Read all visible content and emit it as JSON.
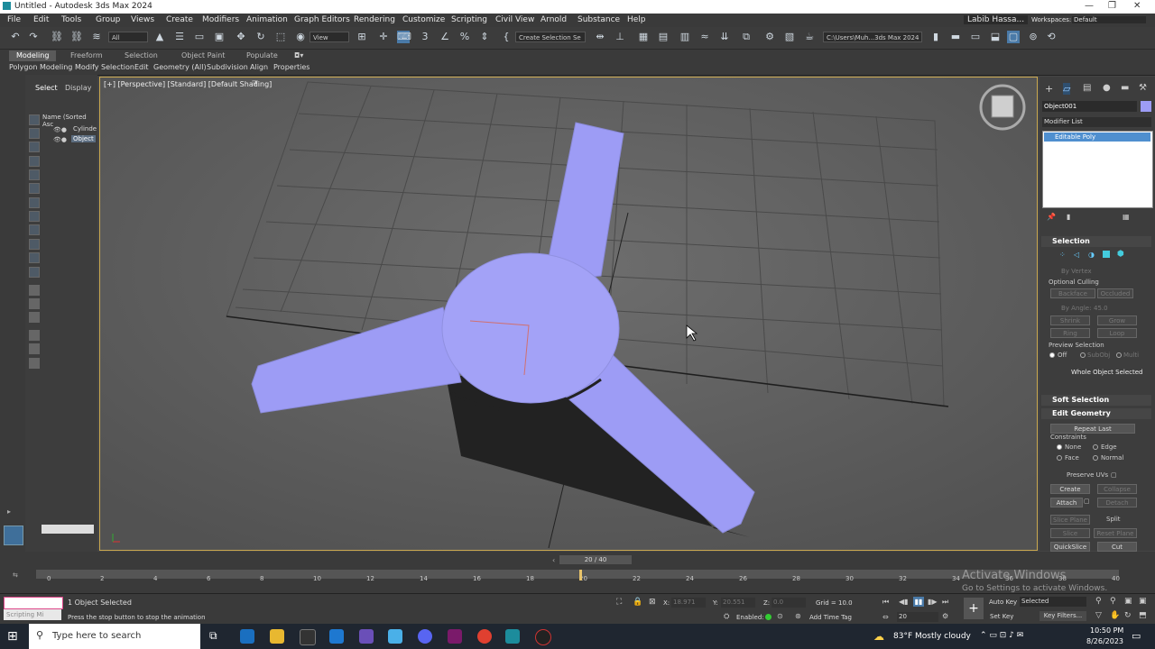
{
  "window": {
    "title": "Untitled - Autodesk 3ds Max 2024",
    "controls": [
      "—",
      "❐",
      "✕"
    ]
  },
  "menus": [
    "File",
    "Edit",
    "Tools",
    "Group",
    "Views",
    "Create",
    "Modifiers",
    "Animation",
    "Graph Editors",
    "Rendering",
    "Customize",
    "Scripting",
    "Civil View",
    "Arnold",
    "Substance",
    "Help"
  ],
  "user": {
    "name": "Labib Hassa...",
    "workspace_label": "Workspaces:",
    "workspace": "Default"
  },
  "toolbar": {
    "filter": "All",
    "view": "View",
    "selection_set": "Create Selection Se",
    "path": "C:\\Users\\Muh...3ds Max 2024"
  },
  "ribbon": {
    "tabs": [
      "Modeling",
      "Freeform",
      "Selection",
      "Object Paint",
      "Populate"
    ],
    "active_tab": "Modeling",
    "subtabs": [
      "Polygon Modeling",
      "Modify Selection",
      "Edit",
      "Geometry (All)",
      "Subdivision",
      "Align",
      "Properties"
    ]
  },
  "scene_explorer": {
    "tabs": [
      "Select",
      "Display"
    ],
    "column_header": "Name (Sorted Asc",
    "items": [
      "Cylinde",
      "Object"
    ]
  },
  "viewport": {
    "label": "[+] [Perspective] [Standard] [Default Shading]",
    "object_color": "#9d9cf5"
  },
  "command_panel": {
    "object_name": "Object001",
    "modifier_list_label": "Modifier List",
    "stack_item": "Editable Poly",
    "selection": {
      "title": "Selection",
      "by_vertex": "By Vertex",
      "optional_culling": "Optional Culling",
      "backface": "Backface",
      "occluded": "Occluded",
      "by_angle": "By Angle:",
      "angle_value": "45.0",
      "shrink": "Shrink",
      "grow": "Grow",
      "ring": "Ring",
      "loop": "Loop",
      "preview_selection": "Preview Selection",
      "preview_options": [
        "Off",
        "SubObj",
        "Multi"
      ],
      "whole_object": "Whole Object Selected"
    },
    "soft_selection": "Soft Selection",
    "edit_geometry": {
      "title": "Edit Geometry",
      "repeat_last": "Repeat Last",
      "constraints": "Constraints",
      "constraint_options": [
        "None",
        "Edge",
        "Face",
        "Normal"
      ],
      "preserve_uvs": "Preserve UVs",
      "create": "Create",
      "collapse": "Collapse",
      "attach": "Attach",
      "detach": "Detach",
      "slice_plane": "Slice Plane",
      "split": "Split",
      "slice": "Slice",
      "reset_plane": "Reset Plane",
      "quickslice": "QuickSlice",
      "cut": "Cut"
    }
  },
  "timeline": {
    "frame_label": "20 / 40",
    "current_frame": 20,
    "total_frames": 40,
    "ticks": [
      "0",
      "2",
      "4",
      "6",
      "8",
      "10",
      "12",
      "14",
      "16",
      "18",
      "20",
      "22",
      "24",
      "26",
      "28",
      "30",
      "32",
      "34",
      "36",
      "38",
      "40"
    ]
  },
  "watermark": {
    "line1": "Activate Windows",
    "line2": "Go to Settings to activate Windows."
  },
  "status": {
    "script_box": "Scripting Mi",
    "selected": "1 Object Selected",
    "prompt": "Press the stop button to stop the animation",
    "x_label": "X:",
    "x_value": "18.971",
    "y_label": "Y:",
    "y_value": "20.551",
    "z_label": "Z:",
    "z_value": "0.0",
    "grid": "Grid = 10.0",
    "enabled": "Enabled:",
    "add_time_tag": "Add Time Tag",
    "auto_key": "Auto Key",
    "set_key": "Set Key",
    "selected_dd": "Selected",
    "key_filters": "Key Filters...",
    "frame_field": "20"
  },
  "taskbar": {
    "search_placeholder": "Type here to search",
    "weather": "83°F  Mostly cloudy",
    "time": "10:50 PM",
    "date": "8/26/2023"
  }
}
